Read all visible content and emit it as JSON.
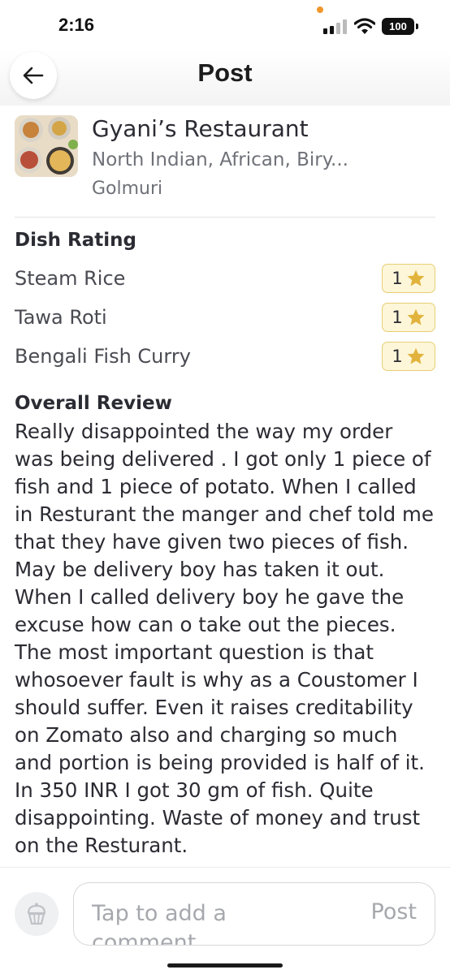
{
  "status_bar": {
    "time": "2:16",
    "battery": "100",
    "icons": [
      "signal-icon",
      "wifi-icon",
      "battery-icon"
    ]
  },
  "header": {
    "title": "Post",
    "back_icon": "arrow-left-icon"
  },
  "restaurant": {
    "name": "Gyani’s Restaurant",
    "cuisine": "North Indian, African, Biry...",
    "area": "Golmuri"
  },
  "dish_rating": {
    "title": "Dish Rating",
    "dishes": [
      {
        "name": "Steam Rice",
        "rating": "1"
      },
      {
        "name": "Tawa Roti",
        "rating": "1"
      },
      {
        "name": "Bengali Fish Curry",
        "rating": "1"
      }
    ]
  },
  "review": {
    "title": "Overall Review",
    "text": "Really disappointed the way my order was being delivered . I got only 1 piece of fish and 1 piece of potato. When I called in Resturant the manger and chef told me that they have given two pieces of fish. May be delivery boy has taken it out. When I called delivery boy he gave the excuse how can o take out the pieces. The most important question is that whosoever fault is why as a Coustomer I should suffer. Even it raises creditability on Zomato also and charging so much and portion is being provided is half of it. In 350 INR I got 30 gm of fish. Quite disappointing. Waste of money and trust on the Resturant."
  },
  "comment_bar": {
    "placeholder": "Tap to add a comment",
    "post_label": "Post"
  },
  "colors": {
    "star": "#e2b33c",
    "badge_bg": "#fdf6d8",
    "badge_border": "#e8cf73",
    "status_dot": "#f0962b"
  }
}
